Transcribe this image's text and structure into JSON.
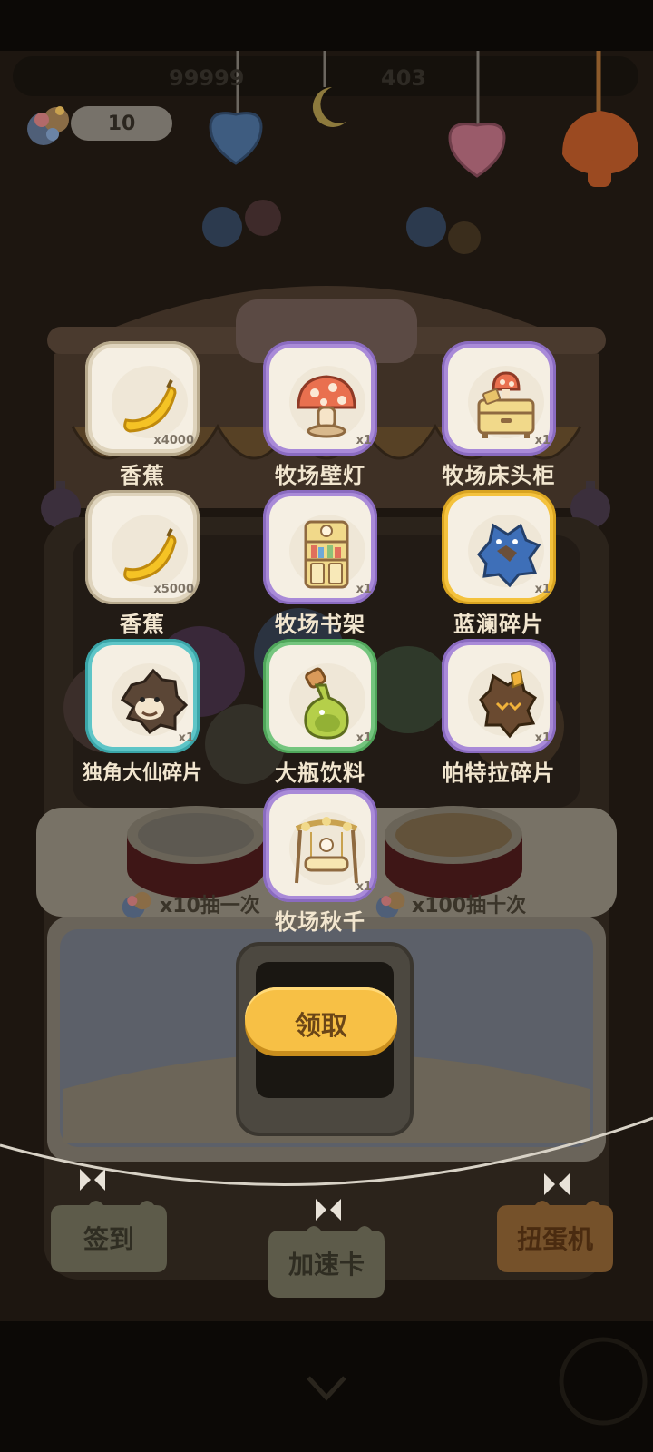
{
  "header": {
    "tickets": "10",
    "faded_stat_left": "99999",
    "faded_stat_right": "403"
  },
  "rewards": [
    {
      "name": "香蕉",
      "qty": "x4000",
      "rarity": "white",
      "icon": "banana-icon"
    },
    {
      "name": "牧场壁灯",
      "qty": "x1",
      "rarity": "purple",
      "icon": "mushroom-lamp-icon"
    },
    {
      "name": "牧场床头柜",
      "qty": "x1",
      "rarity": "purple",
      "icon": "nightstand-icon"
    },
    {
      "name": "香蕉",
      "qty": "x5000",
      "rarity": "white",
      "icon": "banana-icon"
    },
    {
      "name": "牧场书架",
      "qty": "x1",
      "rarity": "purple",
      "icon": "bookshelf-icon"
    },
    {
      "name": "蓝澜碎片",
      "qty": "x1",
      "rarity": "gold",
      "icon": "blue-fragment-icon"
    },
    {
      "name": "独角大仙碎片",
      "qty": "x1",
      "rarity": "teal",
      "icon": "unicorn-fragment-icon"
    },
    {
      "name": "大瓶饮料",
      "qty": "x1",
      "rarity": "green",
      "icon": "drink-bottle-icon"
    },
    {
      "name": "帕特拉碎片",
      "qty": "x1",
      "rarity": "purple",
      "icon": "patra-fragment-icon"
    },
    {
      "name": "牧场秋千",
      "qty": "x1",
      "rarity": "purple",
      "icon": "swing-icon"
    }
  ],
  "machine": {
    "draw_one": "x10抽一次",
    "draw_ten": "x100抽十次",
    "claim_button": "领取"
  },
  "bottom_nav": {
    "checkin": "签到",
    "speed_card": "加速卡",
    "gacha": "扭蛋机"
  },
  "colors": {
    "rarity_white": "#dfd4bd",
    "rarity_purple": "#a98ad8",
    "rarity_gold": "#f4c23d",
    "rarity_teal": "#5ec5c7",
    "rarity_green": "#74c57e",
    "claim_button": "#f7c045"
  }
}
